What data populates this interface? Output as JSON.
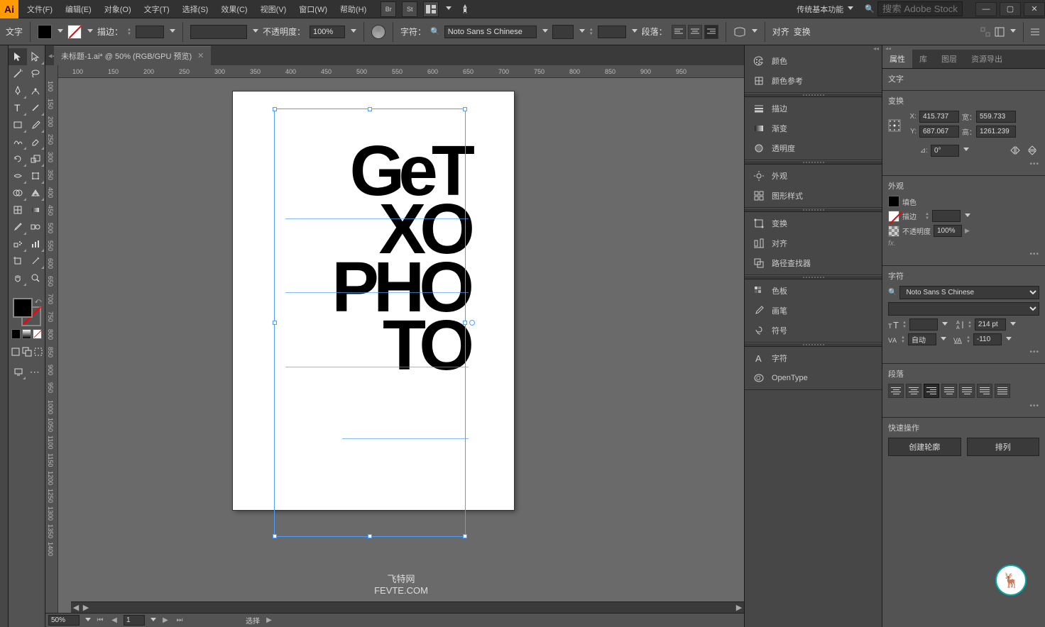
{
  "app": {
    "logo": "Ai"
  },
  "menubar": {
    "items": [
      "文件(F)",
      "编辑(E)",
      "对象(O)",
      "文字(T)",
      "选择(S)",
      "效果(C)",
      "视图(V)",
      "窗口(W)",
      "帮助(H)"
    ],
    "extras": [
      "Br",
      "St"
    ],
    "workspace": "传统基本功能",
    "search_placeholder": "搜索 Adobe Stock"
  },
  "controlbar": {
    "type_label": "文字",
    "stroke_label": "描边：",
    "stroke_weight": "",
    "opacity_label": "不透明度：",
    "opacity_value": "100%",
    "char_label": "字符：",
    "font_name": "Noto Sans S Chinese",
    "para_label": "段落：",
    "align_label": "对齐",
    "transform_label": "变换"
  },
  "document": {
    "tab_title": "未标题-1.ai* @ 50% (RGB/GPU 预览)",
    "zoom": "50%",
    "page": "1",
    "tool_hint": "选择"
  },
  "ruler_h": [
    "100",
    "150",
    "200",
    "250",
    "300",
    "350",
    "400",
    "450",
    "500",
    "550",
    "600",
    "650",
    "700",
    "750",
    "800",
    "850",
    "900",
    "950"
  ],
  "ruler_v": [
    "100",
    "150",
    "200",
    "250",
    "300",
    "350",
    "400",
    "450",
    "500",
    "550",
    "600",
    "650",
    "700",
    "750",
    "800",
    "850",
    "900",
    "950",
    "1000",
    "1050",
    "1100",
    "1150",
    "1200",
    "1250",
    "1300",
    "1350",
    "1400"
  ],
  "artwork": {
    "line1": "GeT",
    "line2": "XO",
    "line3": "PHO",
    "line4": "TO"
  },
  "panel_strip": {
    "g1": [
      {
        "icon": "palette",
        "label": "颜色"
      },
      {
        "icon": "guide",
        "label": "颜色参考"
      }
    ],
    "g2": [
      {
        "icon": "lines",
        "label": "描边"
      },
      {
        "icon": "gradient",
        "label": "渐变"
      },
      {
        "icon": "circle",
        "label": "透明度"
      }
    ],
    "g3": [
      {
        "icon": "sun",
        "label": "外观"
      },
      {
        "icon": "grid",
        "label": "图形样式"
      }
    ],
    "g4": [
      {
        "icon": "transform",
        "label": "变换"
      },
      {
        "icon": "align",
        "label": "对齐"
      },
      {
        "icon": "pathfinder",
        "label": "路径查找器"
      }
    ],
    "g5": [
      {
        "icon": "swatches",
        "label": "色板"
      },
      {
        "icon": "brush",
        "label": "画笔"
      },
      {
        "icon": "symbol",
        "label": "符号"
      }
    ],
    "g6": [
      {
        "icon": "char",
        "label": "字符"
      },
      {
        "icon": "opentype",
        "label": "OpenType"
      }
    ]
  },
  "rp": {
    "tabs": [
      "属性",
      "库",
      "图层",
      "资源导出"
    ],
    "active_tab": 0,
    "object_type": "文字",
    "transform": {
      "title": "变换",
      "x": "415.737",
      "y": "687.067",
      "w": "559.733",
      "h": "1261.239",
      "x_lbl": "X:",
      "y_lbl": "Y:",
      "w_lbl": "宽：",
      "h_lbl": "高：",
      "angle_lbl": "⊿:",
      "angle": "0°"
    },
    "appearance": {
      "title": "外观",
      "fill": "填色",
      "stroke": "描边",
      "opacity_lbl": "不透明度",
      "opacity": "100%",
      "fx": "fx."
    },
    "char": {
      "title": "字符",
      "font": "Noto Sans S Chinese",
      "style": "",
      "size": "",
      "leading": "214 pt",
      "kerning": "自动",
      "tracking": "-110"
    },
    "para": {
      "title": "段落"
    },
    "quick": {
      "title": "快速操作",
      "outline": "创建轮廓",
      "arrange": "排列"
    }
  },
  "watermark": {
    "site": "飞特网",
    "url": "FEVTE.COM"
  }
}
